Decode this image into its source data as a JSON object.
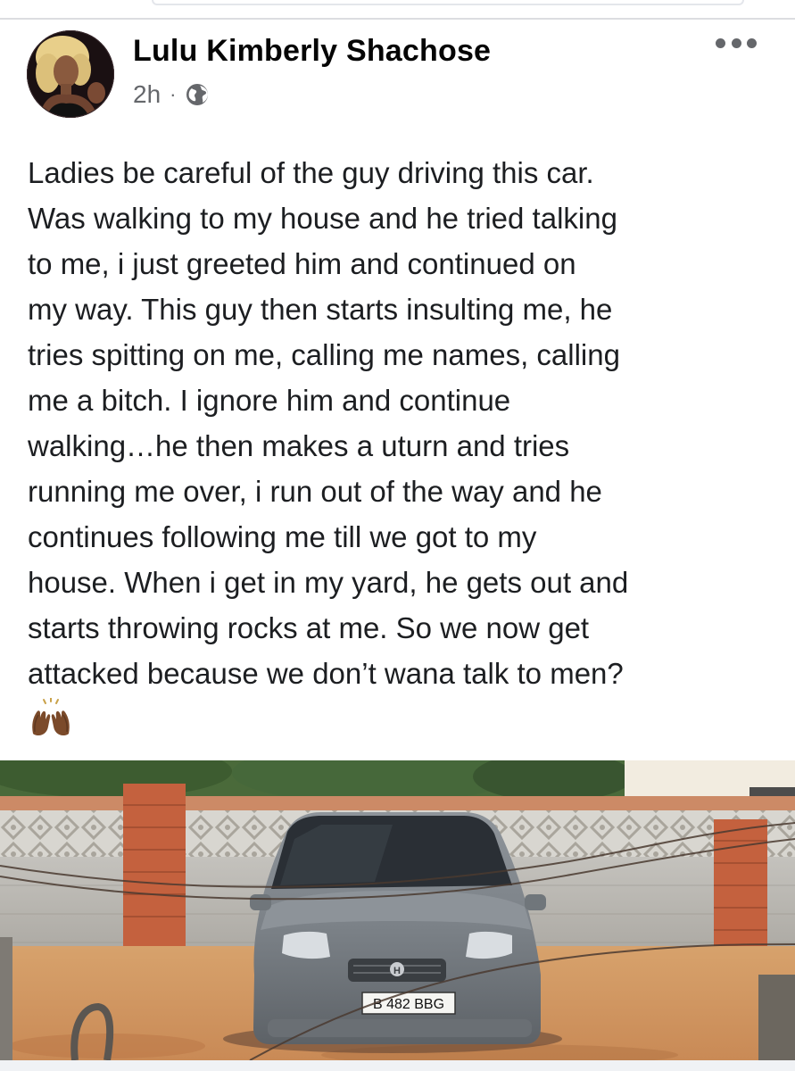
{
  "post": {
    "author_name": "Lulu Kimberly Shachose",
    "timestamp": "2h",
    "separator": "·",
    "privacy_icon": "globe-icon",
    "more_icon": "more-options-icon",
    "text": "Ladies be careful of the guy driving this car.\nWas walking to my house and he tried talking\nto me, i just greeted him and continued on\nmy way. This guy then starts insulting me, he\ntries spitting on me, calling me names, calling\nme a bitch. I ignore him and continue\nwalking…he then makes a uturn and tries\nrunning me over, i run out of the way and he\ncontinues following me till we got to my\nhouse. When i get in my yard, he gets out and\nstarts throwing rocks at me. So we now get\nattacked because we don’t wana talk to men?",
    "emoji_icon": "raising-hands-icon",
    "photo": {
      "license_plate": "B 482 BBG",
      "car_badge": "H"
    }
  },
  "colors": {
    "name": "#050505",
    "meta": "#65676b",
    "body_text": "#1c1e21",
    "divider": "#dcdde0"
  }
}
